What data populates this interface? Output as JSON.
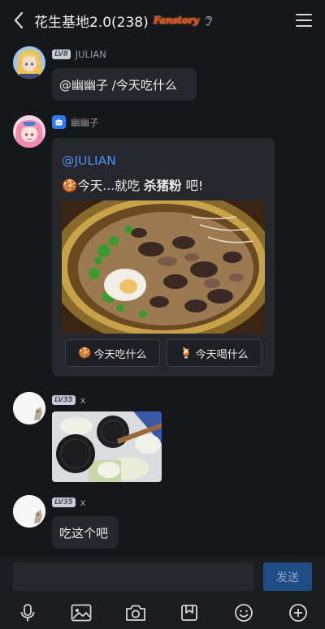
{
  "header": {
    "title": "花生基地2.0(238)",
    "badge_text": "Fanstory",
    "back_icon": "chevron-left-icon",
    "menu_icon": "hamburger-menu-icon"
  },
  "messages": [
    {
      "sender": "JULIAN",
      "level": "LV8",
      "text": "@幽幽子 /今天吃什么"
    },
    {
      "sender": "幽幽子",
      "is_bot": true,
      "mention": "@JULIAN",
      "line_prefix": "🍪今天...就吃 ",
      "line_bold": "杀猪粉",
      "line_suffix": " 吧!",
      "buttons": [
        {
          "emoji": "🍪",
          "label": "今天吃什么"
        },
        {
          "emoji": "🍹",
          "label": "今天喝什么"
        }
      ]
    },
    {
      "sender": "x",
      "level": "LV35",
      "type": "image"
    },
    {
      "sender": "x",
      "level": "LV35",
      "text": "吃这个吧"
    }
  ],
  "composer": {
    "input_value": "",
    "send_label": "发送"
  },
  "toolbar": [
    "mic-icon",
    "image-icon",
    "camera-icon",
    "bookmark-icon",
    "emoji-icon",
    "plus-icon"
  ],
  "colors": {
    "background": "#16171b",
    "bubble": "#26272d",
    "mention": "#4f8ef7",
    "send_button": "#1e4d86"
  }
}
